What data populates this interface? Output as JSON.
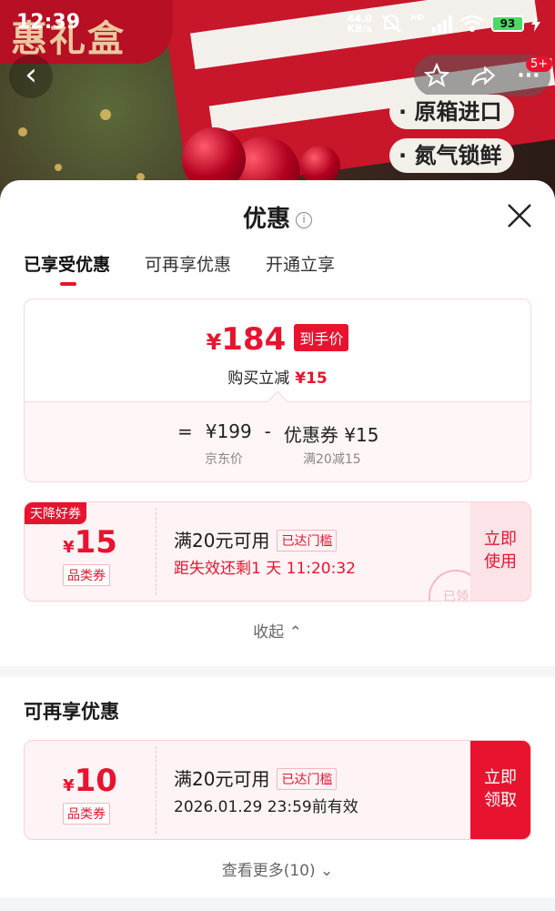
{
  "status": {
    "time": "12:39",
    "speed_value": "44.0",
    "speed_unit": "KB/s",
    "hd": "HD",
    "battery": "93"
  },
  "banner": {
    "title": "惠礼盒",
    "badge": "5+",
    "features": [
      "· 原箱进口",
      "· 氮气锁鲜"
    ]
  },
  "sheet": {
    "title": "优惠",
    "tabs": [
      "已享受优惠",
      "可再享优惠",
      "开通立享"
    ],
    "price": {
      "yen": "¥",
      "final": "184",
      "tag": "到手价",
      "reduce_label": "购买立减",
      "reduce_amount": "¥15",
      "eq": "=",
      "original": "¥199",
      "minus": "-",
      "coupon_label": "优惠券",
      "coupon_amount": "¥15",
      "original_label": "京东价",
      "coupon_rule": "满20减15"
    },
    "coupon1": {
      "corner": "天降好券",
      "yen": "¥",
      "amount": "15",
      "category": "品类券",
      "condition": "满20元可用",
      "reached": "已达门槛",
      "expire": "距失效还剩1 天 11:20:32",
      "action": [
        "立即",
        "使用"
      ],
      "stamp": "已领"
    },
    "collapse": "收起",
    "section2": "可再享优惠",
    "coupon2": {
      "yen": "¥",
      "amount": "10",
      "category": "品类券",
      "condition": "满20元可用",
      "reached": "已达门槛",
      "expire": "2026.01.29 23:59前有效",
      "action": [
        "立即",
        "领取"
      ]
    },
    "more": "查看更多(10)"
  },
  "colors": {
    "accent": "#e8142f",
    "sheet_bg": "#ffffff",
    "soft_pink": "#fff4f5"
  }
}
